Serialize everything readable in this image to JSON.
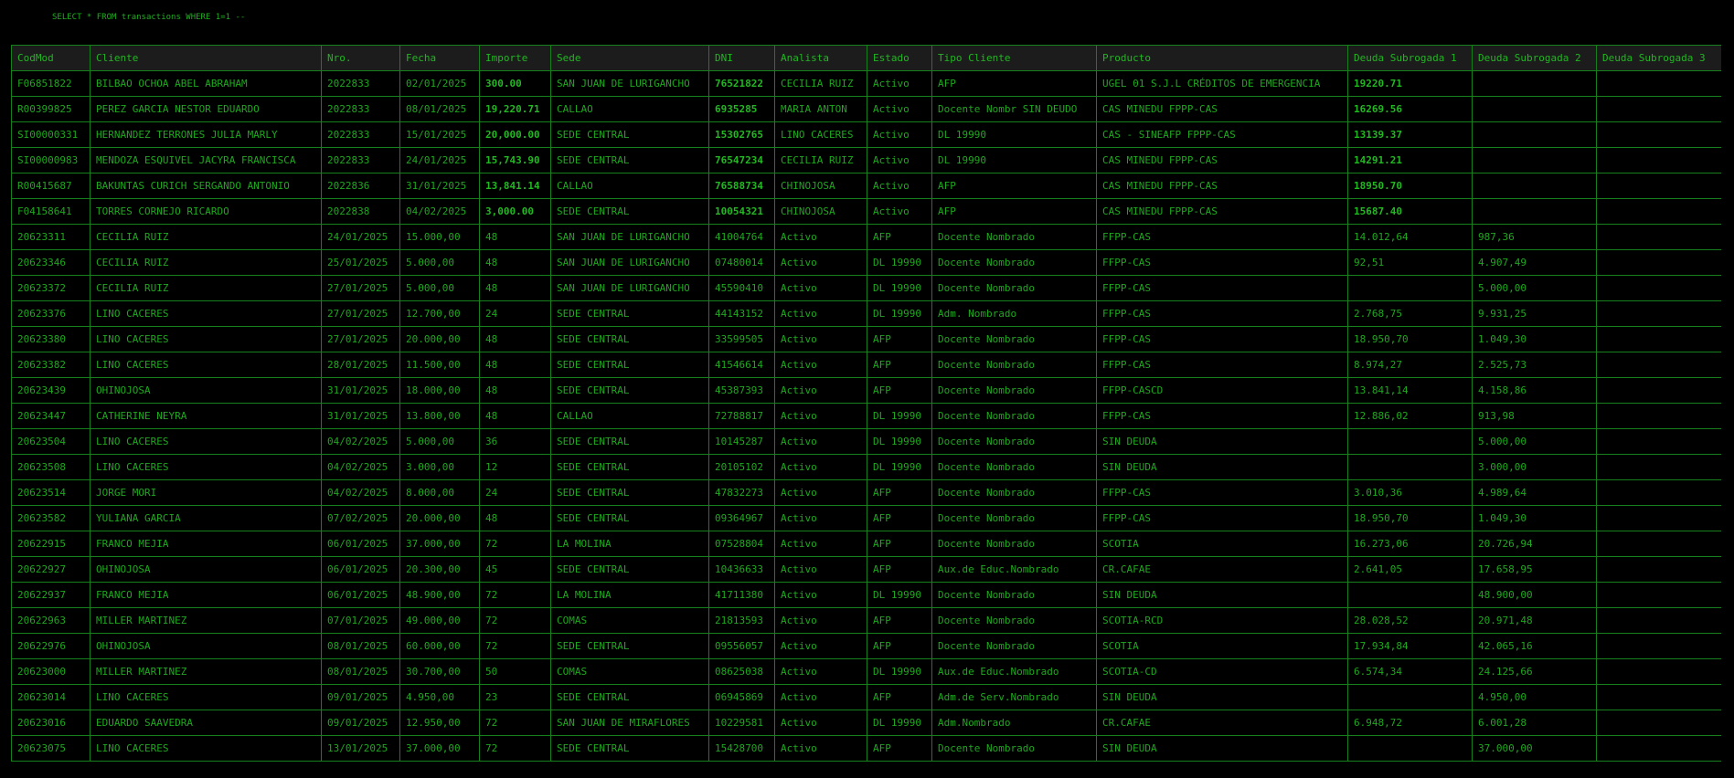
{
  "query": "SELECT * FROM transactions WHERE 1=1 --",
  "colors": {
    "background": "#000000",
    "text": "#1fae1f",
    "border": "#15801c",
    "header_bg": "#1c1c1c"
  },
  "columns": [
    "CodMod",
    "Cliente",
    "Nro.",
    "Fecha",
    "Importe",
    "Sede",
    "DNI",
    "Analista",
    "Estado",
    "Tipo Cliente",
    "Producto",
    "Deuda Subrogada 1",
    "Deuda Subrogada 2",
    "Deuda Subrogada 3"
  ],
  "rows": [
    [
      "F06851822",
      "BILBAO OCHOA ABEL ABRAHAM",
      "2022833",
      "02/01/2025",
      "300.00",
      "SAN JUAN DE LURIGANCHO",
      "76521822",
      "CECILIA RUIZ",
      "Activo",
      "AFP",
      "UGEL 01 S.J.L CRÉDITOS DE EMERGENCIA",
      "19220.71",
      "",
      ""
    ],
    [
      "R00399825",
      "PEREZ GARCIA NESTOR EDUARDO",
      "2022833",
      "08/01/2025",
      "19,220.71",
      "CALLAO",
      "6935285",
      "MARIA ANTON",
      "Activo",
      "Docente Nombr SIN DEUDO",
      "CAS MINEDU FPPP-CAS",
      "16269.56",
      "",
      ""
    ],
    [
      "SI00000331",
      "HERNANDEZ TERRONES JULIA MARLY",
      "2022833",
      "15/01/2025",
      "20,000.00",
      "SEDE CENTRAL",
      "15302765",
      "LINO CACERES",
      "Activo",
      "DL 19990",
      "CAS - SINEAFP FPPP-CAS",
      "13139.37",
      "",
      ""
    ],
    [
      "SI00000983",
      "MENDOZA ESQUIVEL JACYRA FRANCISCA",
      "2022833",
      "24/01/2025",
      "15,743.90",
      "SEDE CENTRAL",
      "76547234",
      "CECILIA RUIZ",
      "Activo",
      "DL 19990",
      "CAS MINEDU FPPP-CAS",
      "14291.21",
      "",
      ""
    ],
    [
      "R00415687",
      "BAKUNTAS CURICH SERGANDO ANTONIO",
      "2022836",
      "31/01/2025",
      "13,841.14",
      "CALLAO",
      "76588734",
      "CHINOJOSA",
      "Activo",
      "AFP",
      "CAS MINEDU FPPP-CAS",
      "18950.70",
      "",
      ""
    ],
    [
      "F04158641",
      "TORRES CORNEJO RICARDO",
      "2022838",
      "04/02/2025",
      "3,000.00",
      "SEDE CENTRAL",
      "10054321",
      "CHINOJOSA",
      "Activo",
      "AFP",
      "CAS MINEDU FPPP-CAS",
      "15687.40",
      "",
      ""
    ],
    [
      "20623311",
      "CECILIA RUIZ",
      "24/01/2025",
      "15.000,00",
      "48",
      "SAN JUAN DE LURIGANCHO",
      "41004764",
      "Activo",
      "AFP",
      "Docente Nombrado",
      "FFPP-CAS",
      "14.012,64",
      "987,36",
      ""
    ],
    [
      "20623346",
      "CECILIA RUIZ",
      "25/01/2025",
      "5.000,00",
      "48",
      "SAN JUAN DE LURIGANCHO",
      "07480014",
      "Activo",
      "DL 19990",
      "Docente Nombrado",
      "FFPP-CAS",
      "92,51",
      "4.907,49",
      ""
    ],
    [
      "20623372",
      "CECILIA RUIZ",
      "27/01/2025",
      "5.000,00",
      "48",
      "SAN JUAN DE LURIGANCHO",
      "45590410",
      "Activo",
      "DL 19990",
      "Docente Nombrado",
      "FFPP-CAS",
      "",
      "5.000,00",
      ""
    ],
    [
      "20623376",
      "LINO CACERES",
      "27/01/2025",
      "12.700,00",
      "24",
      "SEDE CENTRAL",
      "44143152",
      "Activo",
      "DL 19990",
      "Adm. Nombrado",
      "FFPP-CAS",
      "2.768,75",
      "9.931,25",
      ""
    ],
    [
      "20623380",
      "LINO CACERES",
      "27/01/2025",
      "20.000,00",
      "48",
      "SEDE CENTRAL",
      "33599505",
      "Activo",
      "AFP",
      "Docente Nombrado",
      "FFPP-CAS",
      "18.950,70",
      "1.049,30",
      ""
    ],
    [
      "20623382",
      "LINO CACERES",
      "28/01/2025",
      "11.500,00",
      "48",
      "SEDE CENTRAL",
      "41546614",
      "Activo",
      "AFP",
      "Docente Nombrado",
      "FFPP-CAS",
      "8.974,27",
      "2.525,73",
      ""
    ],
    [
      "20623439",
      "OHINOJOSA",
      "31/01/2025",
      "18.000,00",
      "48",
      "SEDE CENTRAL",
      "45387393",
      "Activo",
      "AFP",
      "Docente Nombrado",
      "FFPP-CASCD",
      "13.841,14",
      "4.158,86",
      ""
    ],
    [
      "20623447",
      "CATHERINE NEYRA",
      "31/01/2025",
      "13.800,00",
      "48",
      "CALLAO",
      "72788817",
      "Activo",
      "DL 19990",
      "Docente Nombrado",
      "FFPP-CAS",
      "12.886,02",
      "913,98",
      ""
    ],
    [
      "20623504",
      "LINO CACERES",
      "04/02/2025",
      "5.000,00",
      "36",
      "SEDE CENTRAL",
      "10145287",
      "Activo",
      "DL 19990",
      "Docente Nombrado",
      "SIN DEUDA",
      "",
      "5.000,00",
      ""
    ],
    [
      "20623508",
      "LINO CACERES",
      "04/02/2025",
      "3.000,00",
      "12",
      "SEDE CENTRAL",
      "20105102",
      "Activo",
      "DL 19990",
      "Docente Nombrado",
      "SIN DEUDA",
      "",
      "3.000,00",
      ""
    ],
    [
      "20623514",
      "JORGE MORI",
      "04/02/2025",
      "8.000,00",
      "24",
      "SEDE CENTRAL",
      "47832273",
      "Activo",
      "AFP",
      "Docente Nombrado",
      "FFPP-CAS",
      "3.010,36",
      "4.989,64",
      ""
    ],
    [
      "20623582",
      "YULIANA GARCIA",
      "07/02/2025",
      "20.000,00",
      "48",
      "SEDE CENTRAL",
      "09364967",
      "Activo",
      "AFP",
      "Docente Nombrado",
      "FFPP-CAS",
      "18.950,70",
      "1.049,30",
      ""
    ],
    [
      "20622915",
      "FRANCO MEJIA",
      "06/01/2025",
      "37.000,00",
      "72",
      "LA MOLINA",
      "07528804",
      "Activo",
      "AFP",
      "Docente Nombrado",
      "SCOTIA",
      "16.273,06",
      "20.726,94",
      ""
    ],
    [
      "20622927",
      "OHINOJOSA",
      "06/01/2025",
      "20.300,00",
      "45",
      "SEDE CENTRAL",
      "10436633",
      "Activo",
      "AFP",
      "Aux.de Educ.Nombrado",
      "CR.CAFAE",
      "2.641,05",
      "17.658,95",
      ""
    ],
    [
      "20622937",
      "FRANCO MEJIA",
      "06/01/2025",
      "48.900,00",
      "72",
      "LA MOLINA",
      "41711380",
      "Activo",
      "DL 19990",
      "Docente Nombrado",
      "SIN DEUDA",
      "",
      "48.900,00",
      ""
    ],
    [
      "20622963",
      "MILLER MARTINEZ",
      "07/01/2025",
      "49.000,00",
      "72",
      "COMAS",
      "21813593",
      "Activo",
      "AFP",
      "Docente Nombrado",
      "SCOTIA-RCD",
      "28.028,52",
      "20.971,48",
      ""
    ],
    [
      "20622976",
      "OHINOJOSA",
      "08/01/2025",
      "60.000,00",
      "72",
      "SEDE CENTRAL",
      "09556057",
      "Activo",
      "AFP",
      "Docente Nombrado",
      "SCOTIA",
      "17.934,84",
      "42.065,16",
      ""
    ],
    [
      "20623000",
      "MILLER MARTINEZ",
      "08/01/2025",
      "30.700,00",
      "50",
      "COMAS",
      "08625038",
      "Activo",
      "DL 19990",
      "Aux.de Educ.Nombrado",
      "SCOTIA-CD",
      "6.574,34",
      "24.125,66",
      ""
    ],
    [
      "20623014",
      "LINO CACERES",
      "09/01/2025",
      "4.950,00",
      "23",
      "SEDE CENTRAL",
      "06945869",
      "Activo",
      "AFP",
      "Adm.de Serv.Nombrado",
      "SIN DEUDA",
      "",
      "4.950,00",
      ""
    ],
    [
      "20623016",
      "EDUARDO SAAVEDRA",
      "09/01/2025",
      "12.950,00",
      "72",
      "SAN JUAN DE MIRAFLORES",
      "10229581",
      "Activo",
      "DL 19990",
      "Adm.Nombrado",
      "CR.CAFAE",
      "6.948,72",
      "6.001,28",
      ""
    ],
    [
      "20623075",
      "LINO CACERES",
      "13/01/2025",
      "37.000,00",
      "72",
      "SEDE CENTRAL",
      "15428700",
      "Activo",
      "AFP",
      "Docente Nombrado",
      "SIN DEUDA",
      "",
      "37.000,00",
      ""
    ]
  ]
}
